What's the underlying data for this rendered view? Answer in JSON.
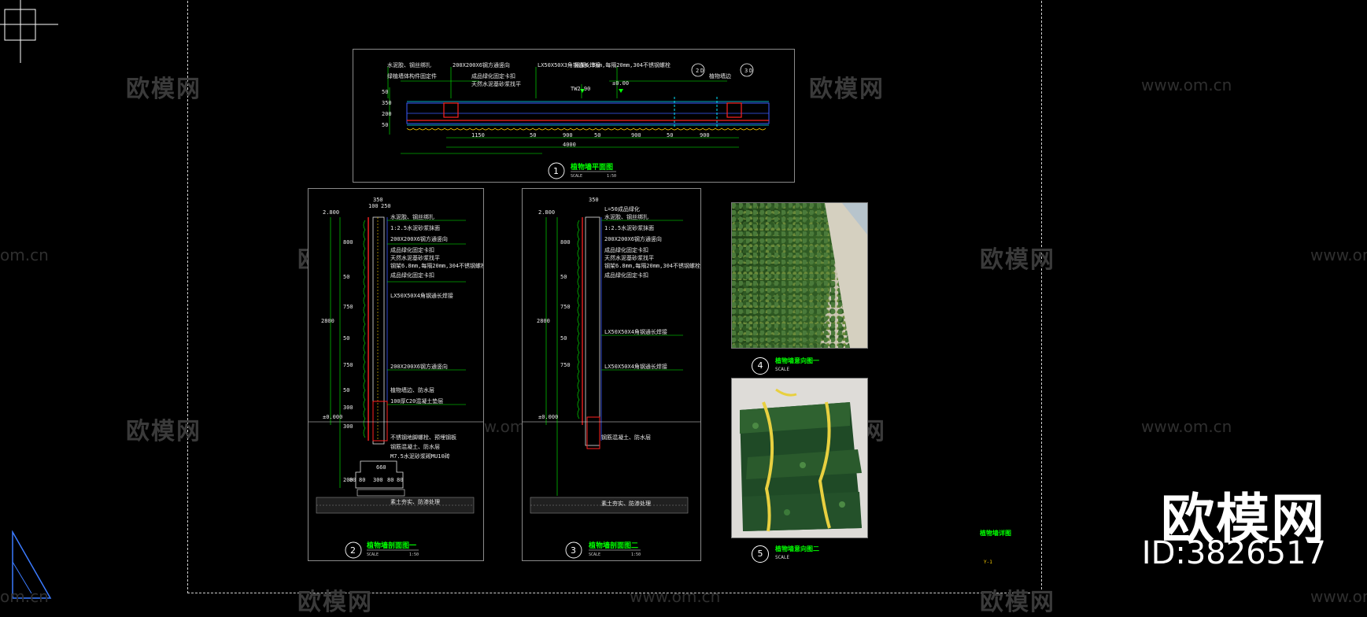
{
  "watermarks": {
    "cn": "欧模网",
    "url": "www.om.cn",
    "url_partial": "om.cn"
  },
  "brand": {
    "name": "欧模网",
    "id": "ID:3826517"
  },
  "sheet": {
    "title": "植物墙详图",
    "number": "Y-1"
  },
  "plan": {
    "number": "1",
    "title": "植物墙平面图",
    "scale_label": "SCALE",
    "scale": "1:50",
    "dims_bottom": [
      "1150",
      "50",
      "900",
      "50",
      "900",
      "50",
      "900"
    ],
    "dim_total": "4000",
    "dims_left": [
      "50",
      "350",
      "200",
      "50"
    ],
    "notes": [
      "水泥胶、钢丝绑扎",
      "绿植墙体构件固定件",
      "200X200X6钢方通竖向",
      "LX50X50X3角钢通长焊接",
      "钢架6.8mm,每隔20mm,304不锈钢螺栓",
      "成品绿化固定卡扣",
      "天然水泥基砂浆找平",
      "TW2.90",
      "±0.00",
      "植物墙边"
    ],
    "callouts": [
      "2",
      "D",
      "3",
      "D"
    ]
  },
  "section1": {
    "number": "2",
    "title": "植物墙剖面图一",
    "scale_label": "SCALE",
    "scale": "1:50",
    "elev_top": "2.800",
    "elev_zero": "±0.000",
    "dims_top": [
      "100",
      "250"
    ],
    "dim_top_total": "350",
    "dims_left": [
      "800",
      "50",
      "750",
      "50",
      "750",
      "50",
      "300",
      "300",
      "200"
    ],
    "dim_left_total": "2800",
    "dims_bottom": [
      "80",
      "80",
      "300",
      "80",
      "80"
    ],
    "dim_bottom_total": "660",
    "notes": [
      "水泥胶、钢丝绑扎",
      "1:2.5水泥砂浆抹面",
      "200X200X6钢方通竖向",
      "成品绿化固定卡扣",
      "天然水泥基砂浆找平",
      "钢架6.8mm,每隔20mm,304不锈钢螺栓",
      "成品绿化固定卡扣",
      "LX50X50X4角钢通长焊接",
      "200X200X6钢方通竖向",
      "植物墙边、防水层",
      "100厚C20混凝土垫层",
      "不锈钢地脚螺栓、预埋钢板",
      "钢筋混凝土、防水层",
      "M7.5水泥砂浆砌MU10砖",
      "素土夯实、防渗处理"
    ]
  },
  "section2": {
    "number": "3",
    "title": "植物墙剖面图二",
    "scale_label": "SCALE",
    "scale": "1:50",
    "elev_top": "2.800",
    "elev_zero": "±0.000",
    "dim_top_total": "350",
    "dims_left": [
      "800",
      "50",
      "750",
      "50",
      "750"
    ],
    "dim_left_total": "2800",
    "notes": [
      "L=50成品绿化",
      "水泥胶、钢丝绑扎",
      "1:2.5水泥砂浆抹面",
      "200X200X6钢方通竖向",
      "成品绿化固定卡扣",
      "天然水泥基砂浆找平",
      "钢架6.8mm,每隔20mm,304不锈钢螺栓",
      "成品绿化固定卡扣",
      "LX50X50X4角钢通长焊接",
      "LX50X50X4角钢通长焊接",
      "钢筋混凝土、防水层",
      "素土夯实、防渗处理"
    ]
  },
  "photo1": {
    "number": "4",
    "title": "植物墙意向图一",
    "scale_label": "SCALE"
  },
  "photo2": {
    "number": "5",
    "title": "植物墙意向图二",
    "scale_label": "SCALE"
  },
  "colors": {
    "background": "#000000",
    "green": "#00ff00",
    "red": "#ff0000",
    "blue": "#3b5bff",
    "cyan": "#00e5ff",
    "yellow": "#ffd000"
  }
}
